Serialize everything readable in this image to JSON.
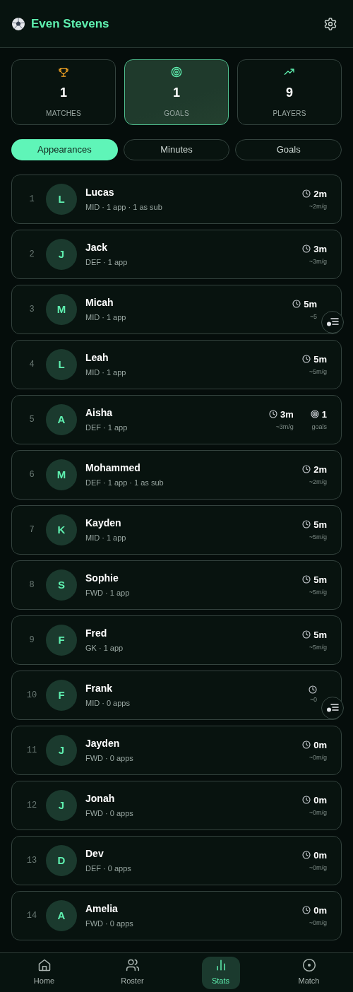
{
  "header": {
    "title": "Even Stevens"
  },
  "summary": [
    {
      "kind": "matches",
      "value": "1",
      "label": "MATCHES",
      "selected": false
    },
    {
      "kind": "goals",
      "value": "1",
      "label": "GOALS",
      "selected": true
    },
    {
      "kind": "players",
      "value": "9",
      "label": "PLAYERS",
      "selected": false
    }
  ],
  "tabs": [
    {
      "label": "Appearances",
      "selected": true
    },
    {
      "label": "Minutes",
      "selected": false
    },
    {
      "label": "Goals",
      "selected": false
    }
  ],
  "players": [
    {
      "rank": "1",
      "initial": "L",
      "name": "Lucas",
      "details": "MID · 1 app · 1 as sub",
      "stats": [
        {
          "kind": "minutes",
          "value": "2m",
          "rate": "~2m/g"
        }
      ],
      "floating_button": false
    },
    {
      "rank": "2",
      "initial": "J",
      "name": "Jack",
      "details": "DEF · 1 app",
      "stats": [
        {
          "kind": "minutes",
          "value": "3m",
          "rate": "~3m/g"
        }
      ],
      "floating_button": false
    },
    {
      "rank": "3",
      "initial": "M",
      "name": "Micah",
      "details": "MID · 1 app",
      "stats": [
        {
          "kind": "minutes",
          "value": "5m",
          "rate": "~5"
        }
      ],
      "floating_button": true
    },
    {
      "rank": "4",
      "initial": "L",
      "name": "Leah",
      "details": "MID · 1 app",
      "stats": [
        {
          "kind": "minutes",
          "value": "5m",
          "rate": "~5m/g"
        }
      ],
      "floating_button": false
    },
    {
      "rank": "5",
      "initial": "A",
      "name": "Aisha",
      "details": "DEF · 1 app",
      "stats": [
        {
          "kind": "minutes",
          "value": "3m",
          "rate": "~3m/g"
        },
        {
          "kind": "goals",
          "value": "1",
          "rate": "goals"
        }
      ],
      "floating_button": false
    },
    {
      "rank": "6",
      "initial": "M",
      "name": "Mohammed",
      "details": "DEF · 1 app · 1 as sub",
      "stats": [
        {
          "kind": "minutes",
          "value": "2m",
          "rate": "~2m/g"
        }
      ],
      "floating_button": false
    },
    {
      "rank": "7",
      "initial": "K",
      "name": "Kayden",
      "details": "MID · 1 app",
      "stats": [
        {
          "kind": "minutes",
          "value": "5m",
          "rate": "~5m/g"
        }
      ],
      "floating_button": false
    },
    {
      "rank": "8",
      "initial": "S",
      "name": "Sophie",
      "details": "FWD · 1 app",
      "stats": [
        {
          "kind": "minutes",
          "value": "5m",
          "rate": "~5m/g"
        }
      ],
      "floating_button": false
    },
    {
      "rank": "9",
      "initial": "F",
      "name": "Fred",
      "details": "GK · 1 app",
      "stats": [
        {
          "kind": "minutes",
          "value": "5m",
          "rate": "~5m/g"
        }
      ],
      "floating_button": false
    },
    {
      "rank": "10",
      "initial": "F",
      "name": "Frank",
      "details": "MID · 0 apps",
      "stats": [
        {
          "kind": "minutes",
          "rate": "~0"
        }
      ],
      "floating_button": true
    },
    {
      "rank": "11",
      "initial": "J",
      "name": "Jayden",
      "details": "FWD · 0 apps",
      "stats": [
        {
          "kind": "minutes",
          "value": "0m",
          "rate": "~0m/g"
        }
      ],
      "floating_button": false
    },
    {
      "rank": "12",
      "initial": "J",
      "name": "Jonah",
      "details": "FWD · 0 apps",
      "stats": [
        {
          "kind": "minutes",
          "value": "0m",
          "rate": "~0m/g"
        }
      ],
      "floating_button": false
    },
    {
      "rank": "13",
      "initial": "D",
      "name": "Dev",
      "details": "DEF · 0 apps",
      "stats": [
        {
          "kind": "minutes",
          "value": "0m",
          "rate": "~0m/g"
        }
      ],
      "floating_button": false
    },
    {
      "rank": "14",
      "initial": "A",
      "name": "Amelia",
      "details": "FWD · 0 apps",
      "stats": [
        {
          "kind": "minutes",
          "value": "0m",
          "rate": "~0m/g"
        }
      ],
      "floating_button": false
    }
  ],
  "nav": [
    {
      "kind": "home",
      "label": "Home",
      "selected": false
    },
    {
      "kind": "roster",
      "label": "Roster",
      "selected": false
    },
    {
      "kind": "stats",
      "label": "Stats",
      "selected": true
    },
    {
      "kind": "match",
      "label": "Match",
      "selected": false
    }
  ]
}
